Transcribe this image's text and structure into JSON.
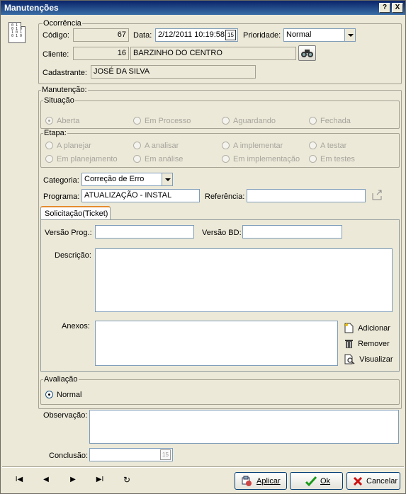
{
  "window": {
    "title": "Manutenções",
    "help_btn": "?",
    "close_btn": "X"
  },
  "ocorrencia": {
    "group_label": "Ocorrência",
    "codigo_label": "Código:",
    "codigo_value": "67",
    "data_label": "Data:",
    "data_value": "2/12/2011 10:19:58",
    "calendar_icon_text": "15",
    "prioridade_label": "Prioridade:",
    "prioridade_value": "Normal",
    "cliente_label": "Cliente:",
    "cliente_id": "16",
    "cliente_name": "BARZINHO DO CENTRO",
    "cadastrante_label": "Cadastrante:",
    "cadastrante_value": "JOSÉ DA SILVA"
  },
  "manutencao": {
    "group_label": "Manutenção:",
    "situacao": {
      "label": "Situação",
      "options": [
        "Aberta",
        "Em Processo",
        "Aguardando",
        "Fechada"
      ],
      "selected": "Aberta"
    },
    "etapa": {
      "label": "Etapa:",
      "options": [
        "A planejar",
        "A analisar",
        "A implementar",
        "A testar",
        "Em planejamento",
        "Em análise",
        "Em implementação",
        "Em testes"
      ]
    },
    "categoria_label": "Categoria:",
    "categoria_value": "Correção de Erro",
    "programa_label": "Programa:",
    "programa_value": "ATUALIZAÇÃO - INSTAL",
    "referencia_label": "Referência:",
    "referencia_value": ""
  },
  "ticket": {
    "tab_label": "Solicitação(Ticket)",
    "versao_prog_label": "Versão Prog.:",
    "versao_prog_value": "",
    "versao_bd_label": "Versão BD:",
    "versao_bd_value": "",
    "descricao_label": "Descrição:",
    "descricao_value": "",
    "anexos_label": "Anexos:",
    "attach_buttons": [
      "Adicionar",
      "Remover",
      "Visualizar"
    ]
  },
  "avaliacao": {
    "group_label": "Avaliação",
    "option": "Normal"
  },
  "observacao_label": "Observação:",
  "observacao_value": "",
  "conclusao_label": "Conclusão:",
  "conclusao_value": "",
  "conclusao_icon_text": "15",
  "footer": {
    "nav_symbols": [
      "I◀",
      "◀",
      "▶",
      "▶I",
      "↻"
    ],
    "aplicar": "Aplicar",
    "ok": "Ok",
    "cancelar": "Cancelar"
  }
}
